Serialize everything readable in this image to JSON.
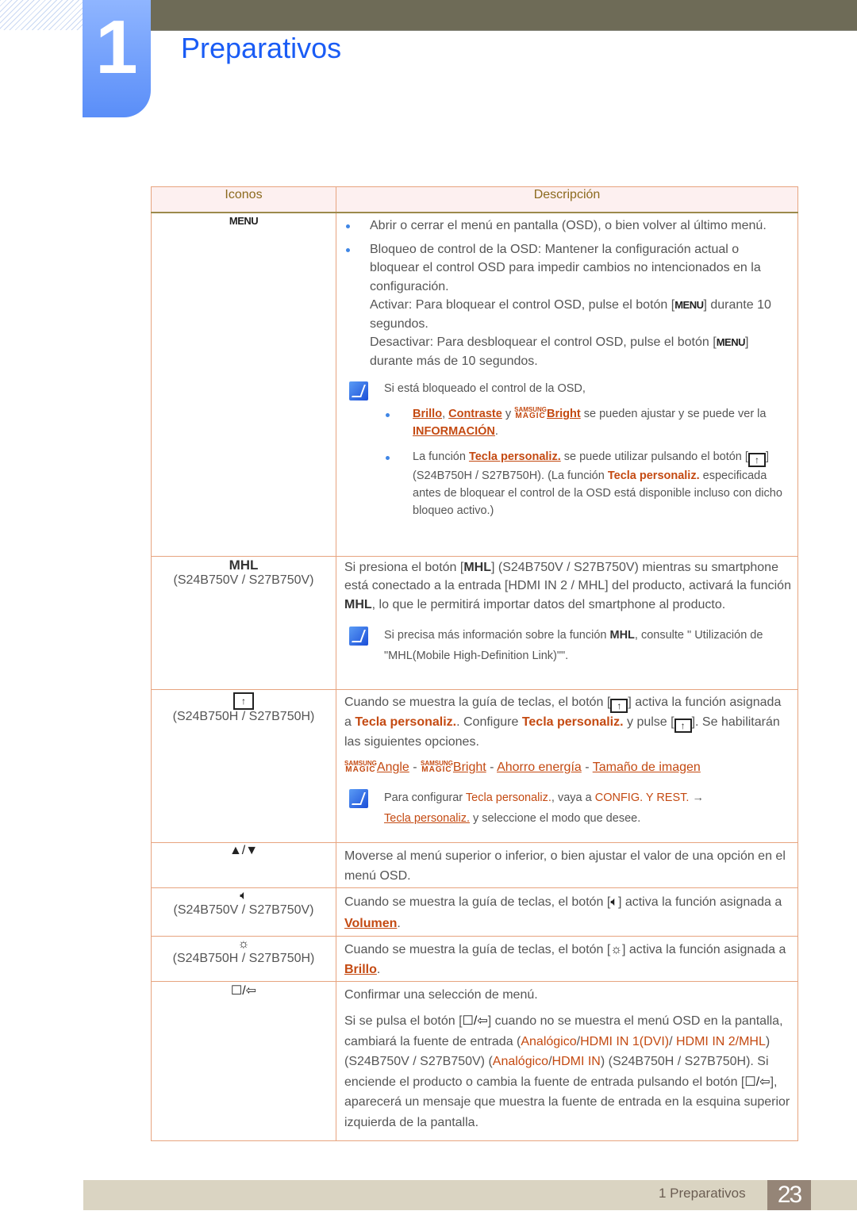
{
  "chapter": {
    "number": "1",
    "title": "Preparativos"
  },
  "table": {
    "headers": {
      "icons": "Iconos",
      "description": "Descripción"
    },
    "rows": {
      "menu": {
        "icon_label": "MENU",
        "bullet1": "Abrir o cerrar el menú en pantalla (OSD), o bien volver al último menú.",
        "bullet2_a": "Bloqueo de control de la OSD: Mantener la configuración actual o bloquear el control OSD para impedir cambios no intencionados en la configuración.",
        "bullet2_b1": "Activar: Para bloquear el control OSD, pulse el botón [",
        "bullet2_b_key": "MENU",
        "bullet2_b2": "] durante 10 segundos.",
        "bullet2_c1": "Desactivar: Para desbloquear el control OSD, pulse el botón [",
        "bullet2_c2": "] durante más de 10 segundos.",
        "note_intro": "Si está bloqueado el control de la OSD,",
        "note_b1_link1": "Brillo",
        "note_b1_sep1": ", ",
        "note_b1_link2": "Contraste",
        "note_b1_y": " y ",
        "magic_top": "SAMSUNG",
        "magic_bottom": "MAGIC",
        "note_b1_link3": "Bright",
        "note_b1_rest": " se pueden ajustar y se puede ver la ",
        "note_b1_link4": "INFORMACIÓN",
        "note_b1_end": ".",
        "note_b2_1": "La función ",
        "note_b2_link": "Tecla personaliz.",
        "note_b2_2": " se puede utilizar pulsando el botón [",
        "note_b2_3": "](S24B750H / S27B750H). (La función ",
        "note_b2_hl": "Tecla personaliz.",
        "note_b2_4": " especificada antes de bloquear el control de la OSD está disponible incluso con dicho bloqueo activo.)"
      },
      "mhl": {
        "icon_label": "MHL",
        "model": "(S24B750V / S27B750V)",
        "p1": "Si presiona el botón [",
        "p1_key": "MHL",
        "p2": "] (S24B750V / S27B750V) mientras su smartphone está conectado a la entrada [HDMI IN 2 / MHL] del producto, activará la función ",
        "p2_key": "MHL",
        "p3": ", lo que le permitirá importar datos del smartphone al producto.",
        "note1": "Si precisa más información sobre la función ",
        "note_key": "MHL",
        "note2": ", consulte \" Utilización de \"MHL(Mobile High-Definition Link)\"\"."
      },
      "custom_key": {
        "model": "(S24B750H / S27B750H)",
        "p1": "Cuando se muestra la guía de teclas, el botón [",
        "p2": "] activa la función asignada a ",
        "hl1": "Tecla personaliz.",
        "p3": ". Configure ",
        "hl2": "Tecla personaliz.",
        "p4": " y pulse [",
        "p5": "]. Se habilitarán las siguientes opciones.",
        "options": [
          "Angle",
          "Bright",
          "Ahorro energía",
          "Tamaño de imagen"
        ],
        "option_sep": " - ",
        "note1": "Para configurar ",
        "note_hl1": "Tecla personaliz.",
        "note2": ", vaya a ",
        "note_hl2": "CONFIG. Y REST.",
        "note_arrow": " → ",
        "note_link": "Tecla personaliz.",
        "note3": " y seleccione el modo que desee."
      },
      "updown": {
        "icon_label": "▲/▼",
        "text": "Moverse al menú superior o inferior, o bien ajustar el valor de una opción en el menú OSD."
      },
      "volume": {
        "model": "(S24B750V / S27B750V)",
        "p1": "Cuando se muestra la guía de teclas, el botón [",
        "p2": "] activa la función asignada a ",
        "link": "Volumen",
        "end": "."
      },
      "brightness": {
        "model": "(S24B750H / S27B750H)",
        "p1": "Cuando se muestra la guía de teclas, el botón [",
        "p2": "] activa la función asignada a ",
        "link": "Brillo",
        "end": "."
      },
      "source": {
        "p0": "Confirmar una selección de menú.",
        "p1": "Si se pulsa el botón [",
        "p2": "] cuando no se muestra el menú OSD en la pantalla, cambiará la fuente de entrada (",
        "hl1": "Analógico",
        "slash1": "/",
        "hl2": "HDMI IN 1(DVI)",
        "slash2": "/ ",
        "hl3": "HDMI IN 2/MHL",
        "p3": ") (S24B750V / S27B750V) (",
        "hl4": "Analógico",
        "slash3": "/",
        "hl5": "HDMI IN",
        "p4": ") (S24B750H / S27B750H). Si enciende el producto o cambia la fuente de entrada pulsando el botón [",
        "p5": "], aparecerá un mensaje que muestra la fuente de entrada en la esquina superior izquierda de la pantalla."
      }
    }
  },
  "footer": {
    "section": "1 Preparativos",
    "page": "23"
  },
  "icons": {
    "note": "note-pen-icon",
    "custom_key": "custom-key-icon",
    "volume": "speaker-icon",
    "brightness": "sun-icon",
    "source": "source-enter-icon"
  },
  "colors": {
    "accent_blue": "#1a5cf5",
    "link_orange": "#c44a12",
    "header_text": "#8c6a1e"
  }
}
